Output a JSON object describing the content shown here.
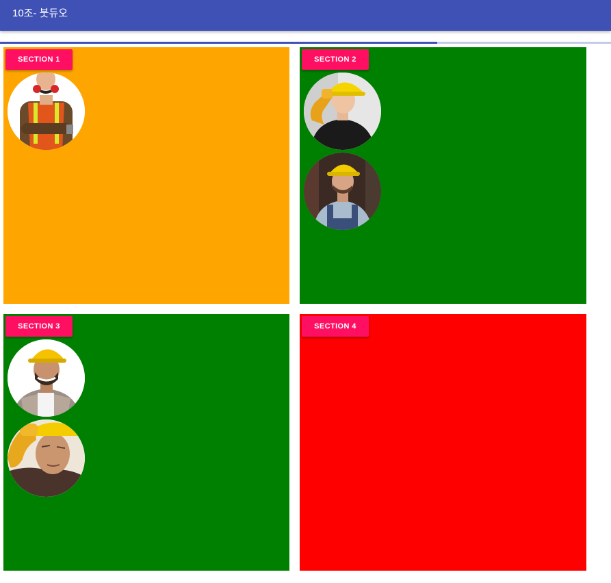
{
  "app": {
    "title": "10조- 붓듀오"
  },
  "progress": {
    "value_percent": 71.6
  },
  "sections": [
    {
      "label": "SECTION 1",
      "background": "#ffa500",
      "avatars": [
        "worker-safety-vest-avatar"
      ]
    },
    {
      "label": "SECTION 2",
      "background": "#008000",
      "avatars": [
        "worker-hardhat-gloves-avatar",
        "worker-overalls-avatar"
      ]
    },
    {
      "label": "SECTION 3",
      "background": "#008000",
      "avatars": [
        "worker-smiling-hardhat-avatar",
        "worker-older-hardhat-avatar"
      ]
    },
    {
      "label": "SECTION 4",
      "background": "#ff0000",
      "avatars": []
    }
  ],
  "colors": {
    "toolbar": "#3f51b5",
    "button": "#ff0f62",
    "progress_track": "#c5cae9"
  }
}
